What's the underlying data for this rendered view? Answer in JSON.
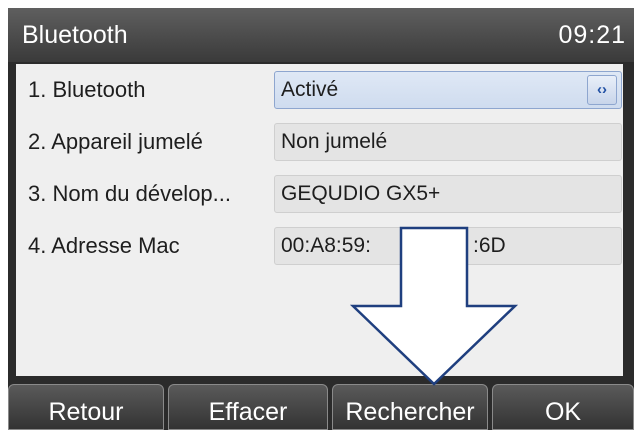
{
  "header": {
    "title": "Bluetooth",
    "time": "09:21"
  },
  "rows": [
    {
      "label": "1. Bluetooth",
      "value": "Activé"
    },
    {
      "label": "2. Appareil jumelé",
      "value": "Non jumelé"
    },
    {
      "label": "3. Nom du dévelop...",
      "value": "GEQUDIO GX5+"
    },
    {
      "label": "4. Adresse Mac",
      "value": "00:A8:59:",
      "value_tail": ":6D"
    }
  ],
  "selector_glyph": "‹›",
  "softkeys": {
    "back": "Retour",
    "clear": "Effacer",
    "search": "Rechercher",
    "ok": "OK"
  },
  "annotation": {
    "icon": "down-arrow-icon",
    "stroke_color": "#1f3f7f",
    "fill_color": "#ffffff"
  },
  "colors": {
    "title_bar": "#4a4a4a",
    "panel": "#efefef",
    "accent": "#1f4fa3"
  }
}
